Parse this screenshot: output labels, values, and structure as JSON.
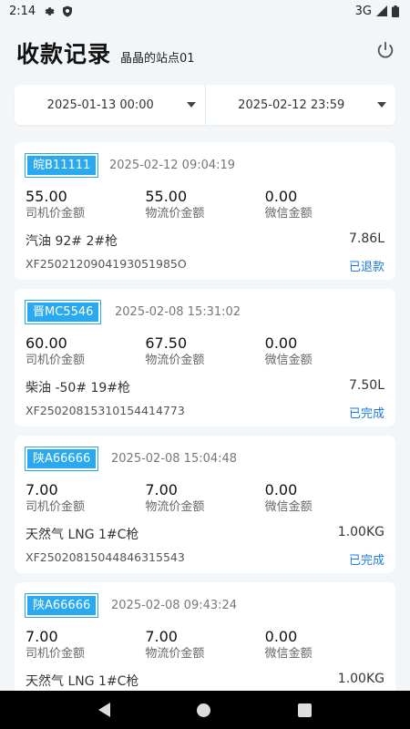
{
  "status_bar": {
    "time": "2:14",
    "network": "3G"
  },
  "header": {
    "title": "收款记录",
    "station": "晶晶的站点01"
  },
  "date_range": {
    "start": "2025-01-13 00:00",
    "end": "2025-02-12 23:59"
  },
  "labels": {
    "driver_price": "司机价金额",
    "logistics_price": "物流价金额",
    "wechat_amount": "微信金额"
  },
  "records": [
    {
      "plate": "皖B11111",
      "time": "2025-02-12 09:04:19",
      "driver_amount": "55.00",
      "logistics_amount": "55.00",
      "wechat_amount": "0.00",
      "fuel": "汽油  92#  2#枪",
      "volume": "7.86L",
      "order_no": "XF2502120904193051985O",
      "status": "已退款"
    },
    {
      "plate": "晋MC5546",
      "time": "2025-02-08 15:31:02",
      "driver_amount": "60.00",
      "logistics_amount": "67.50",
      "wechat_amount": "0.00",
      "fuel": "柴油  -50#  19#枪",
      "volume": "7.50L",
      "order_no": "XF25020815310154414773",
      "status": "已完成"
    },
    {
      "plate": "陕A66666",
      "time": "2025-02-08 15:04:48",
      "driver_amount": "7.00",
      "logistics_amount": "7.00",
      "wechat_amount": "0.00",
      "fuel": "天然气  LNG  1#C枪",
      "volume": "1.00KG",
      "order_no": "XF25020815044846315543",
      "status": "已完成"
    },
    {
      "plate": "陕A66666",
      "time": "2025-02-08 09:43:24",
      "driver_amount": "7.00",
      "logistics_amount": "7.00",
      "wechat_amount": "0.00",
      "fuel": "天然气  LNG  1#C枪",
      "volume": "1.00KG",
      "order_no": "",
      "status": ""
    }
  ],
  "colors": {
    "plate_bg": "#29a9f0",
    "status_link": "#1e7ae0",
    "background": "#f3f6f8"
  }
}
